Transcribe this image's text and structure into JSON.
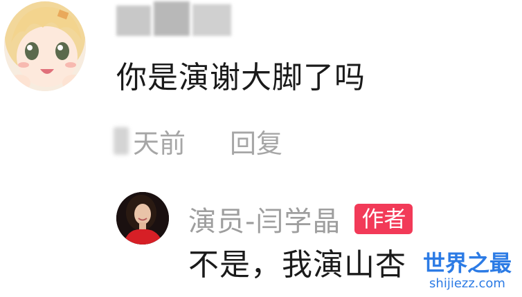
{
  "comment": {
    "text": "你是演谢大脚了吗",
    "time_suffix": "天前",
    "reply_label": "回复"
  },
  "reply": {
    "author": "演员-闫学晶",
    "badge": "作者",
    "text": "不是，我演山杏"
  },
  "watermark": {
    "title": "世界之最",
    "url": "shijiezz.com"
  },
  "colors": {
    "badge": "#f23a58",
    "meta_text": "#a6a6a6",
    "watermark": "#2c7be5"
  },
  "icons": {
    "avatar1": "anime-girl-avatar",
    "avatar2": "woman-red-dress-avatar"
  }
}
